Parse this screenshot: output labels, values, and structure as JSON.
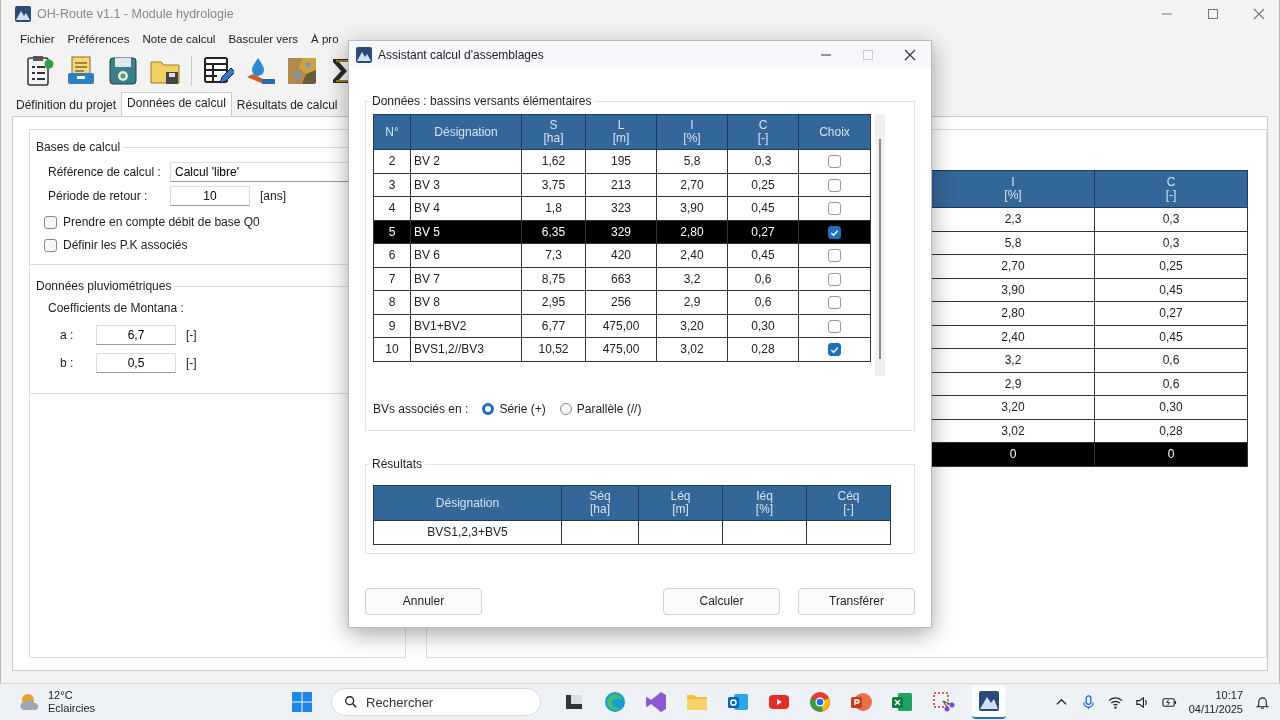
{
  "window": {
    "title": "OH-Route v1.1 - Module hydrologie"
  },
  "menu": [
    "Fichier",
    "Préférences",
    "Note de calcul",
    "Basculer vers",
    "À pro"
  ],
  "tabs": [
    {
      "label": "Définition du projet",
      "selected": false
    },
    {
      "label": "Données de calcul",
      "selected": true
    },
    {
      "label": "Résultats de calcul",
      "selected": false
    }
  ],
  "bases": {
    "title": "Bases de calcul",
    "reference_label": "Référence de calcul :",
    "reference_value": "Calcul 'libre'",
    "periode_label": "Période de retour :",
    "periode_value": "10",
    "periode_unit": "[ans]",
    "options": [
      {
        "label": "Prendre en compte débit de base Q0",
        "checked": false
      },
      {
        "label": "Définir les P.K associés",
        "checked": false
      }
    ]
  },
  "pluvio": {
    "title": "Données pluviométriques",
    "subtitle": "Coefficients de Montana :",
    "coefficients": [
      {
        "label": "a :",
        "value": "6,7",
        "unit": "[-]"
      },
      {
        "label": "b :",
        "value": "0,5",
        "unit": "[-]"
      }
    ]
  },
  "background_table": {
    "columns": [
      {
        "name": "I",
        "unit": "[%]"
      },
      {
        "name": "C",
        "unit": "[-]"
      }
    ],
    "rows": [
      [
        "2,3",
        "0,3"
      ],
      [
        "5,8",
        "0,3"
      ],
      [
        "2,70",
        "0,25"
      ],
      [
        "3,90",
        "0,45"
      ],
      [
        "2,80",
        "0,27"
      ],
      [
        "2,40",
        "0,45"
      ],
      [
        "3,2",
        "0,6"
      ],
      [
        "2,9",
        "0,6"
      ],
      [
        "3,20",
        "0,30"
      ],
      [
        "3,02",
        "0,28"
      ]
    ],
    "total": [
      "0",
      "0"
    ]
  },
  "dialog": {
    "title": "Assistant calcul d'assemblages",
    "data_group": {
      "title": "Données : bassins versants élémentaires",
      "columns": [
        {
          "name": "N°"
        },
        {
          "name": "Désignation"
        },
        {
          "name": "S",
          "unit": "[ha]"
        },
        {
          "name": "L",
          "unit": "[m]"
        },
        {
          "name": "I",
          "unit": "[%]"
        },
        {
          "name": "C",
          "unit": "[-]"
        },
        {
          "name": "Choix"
        }
      ],
      "rows": [
        {
          "cells": [
            "2",
            "BV 2",
            "1,62",
            "195",
            "5,8",
            "0,3"
          ],
          "selected": false,
          "checked": false
        },
        {
          "cells": [
            "3",
            "BV 3",
            "3,75",
            "213",
            "2,70",
            "0,25"
          ],
          "selected": false,
          "checked": false
        },
        {
          "cells": [
            "4",
            "BV 4",
            "1,8",
            "323",
            "3,90",
            "0,45"
          ],
          "selected": false,
          "checked": false
        },
        {
          "cells": [
            "5",
            "BV 5",
            "6,35",
            "329",
            "2,80",
            "0,27"
          ],
          "selected": true,
          "checked": true
        },
        {
          "cells": [
            "6",
            "BV 6",
            "7,3",
            "420",
            "2,40",
            "0,45"
          ],
          "selected": false,
          "checked": false
        },
        {
          "cells": [
            "7",
            "BV 7",
            "8,75",
            "663",
            "3,2",
            "0,6"
          ],
          "selected": false,
          "checked": false
        },
        {
          "cells": [
            "8",
            "BV 8",
            "2,95",
            "256",
            "2,9",
            "0,6"
          ],
          "selected": false,
          "checked": false
        },
        {
          "cells": [
            "9",
            "BV1+BV2",
            "6,77",
            "475,00",
            "3,20",
            "0,30"
          ],
          "selected": false,
          "checked": false
        },
        {
          "cells": [
            "10",
            "BVS1,2//BV3",
            "10,52",
            "475,00",
            "3,02",
            "0,28"
          ],
          "selected": false,
          "checked": true
        }
      ]
    },
    "association": {
      "label": "BVs associés en :",
      "options": [
        {
          "label": "Série (+)",
          "selected": true
        },
        {
          "label": "Parallèle (//)",
          "selected": false
        }
      ]
    },
    "results": {
      "title": "Résultats",
      "columns": [
        {
          "name": "Désignation"
        },
        {
          "name": "Séq",
          "unit": "[ha]"
        },
        {
          "name": "Léq",
          "unit": "[m]"
        },
        {
          "name": "Iéq",
          "unit": "[%]"
        },
        {
          "name": "Céq",
          "unit": "[-]"
        }
      ],
      "rows": [
        {
          "designation": "BVS1,2,3+BV5"
        }
      ]
    },
    "buttons": [
      "Annuler",
      "Calculer",
      "Transférer"
    ]
  },
  "taskbar": {
    "weather": {
      "temp": "12°C",
      "condition": "Eclaircies"
    },
    "search_placeholder": "Rechercher",
    "clock": {
      "time": "10:17",
      "date": "04/11/2025"
    }
  }
}
